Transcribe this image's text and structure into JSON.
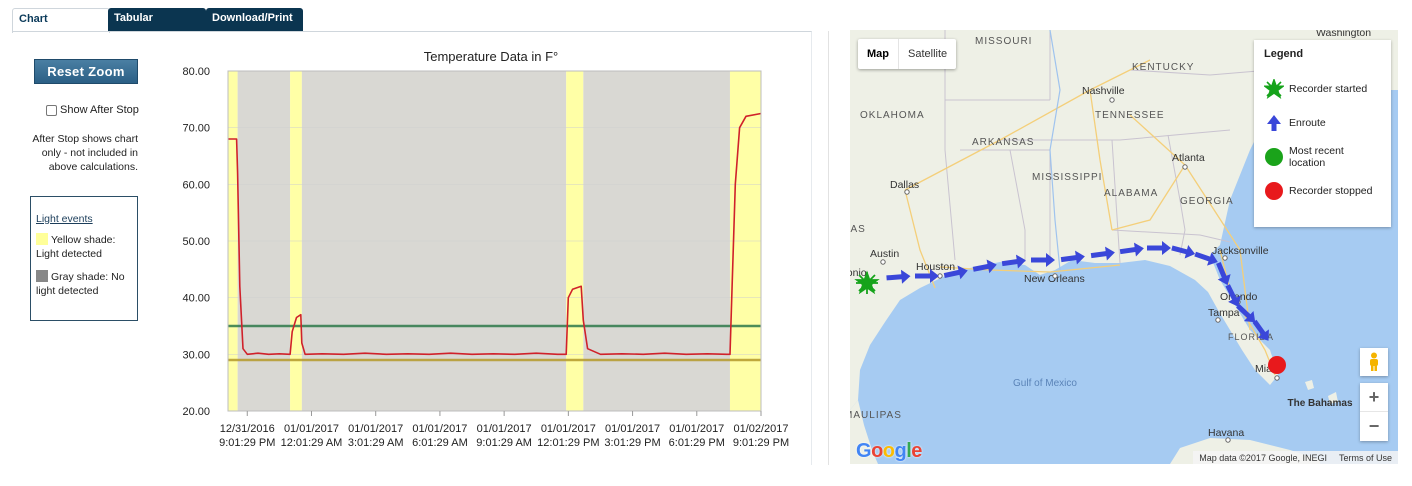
{
  "tabs": [
    {
      "label": "Chart",
      "active": true
    },
    {
      "label": "Tabular",
      "active": false
    },
    {
      "label": "Download/Print",
      "active": false
    }
  ],
  "controls": {
    "reset_zoom": "Reset Zoom",
    "show_after_stop": "Show After Stop",
    "show_after_stop_checked": false,
    "after_stop_note": "After Stop shows chart only - not included in above calculations."
  },
  "light_events": {
    "title": "Light events",
    "yellow": "Yellow shade: Light detected",
    "gray": "Gray shade: No light detected",
    "yellow_color": "#ffff99",
    "gray_color": "#888888"
  },
  "chart_data": {
    "type": "line",
    "title": "Temperature Data in F°",
    "ylim": [
      20,
      80
    ],
    "yticks": [
      "80.00",
      "70.00",
      "60.00",
      "50.00",
      "40.00",
      "30.00",
      "20.00"
    ],
    "xlim_hours": [
      -0.9,
      24.0
    ],
    "xticks": [
      {
        "h": 0,
        "l1": "12/31/2016",
        "l2": "9:01:29 PM"
      },
      {
        "h": 3,
        "l1": "01/01/2017",
        "l2": "12:01:29 AM"
      },
      {
        "h": 6,
        "l1": "01/01/2017",
        "l2": "3:01:29 AM"
      },
      {
        "h": 9,
        "l1": "01/01/2017",
        "l2": "6:01:29 AM"
      },
      {
        "h": 12,
        "l1": "01/01/2017",
        "l2": "9:01:29 AM"
      },
      {
        "h": 15,
        "l1": "01/01/2017",
        "l2": "12:01:29 PM"
      },
      {
        "h": 18,
        "l1": "01/01/2017",
        "l2": "3:01:29 PM"
      },
      {
        "h": 21,
        "l1": "01/01/2017",
        "l2": "6:01:29 PM"
      },
      {
        "h": 24,
        "l1": "01/02/2017",
        "l2": "9:01:29 PM"
      }
    ],
    "bands": [
      {
        "from": -0.9,
        "to": -0.45,
        "kind": "yellow"
      },
      {
        "from": -0.45,
        "to": 2.0,
        "kind": "gray"
      },
      {
        "from": 2.0,
        "to": 2.55,
        "kind": "yellow"
      },
      {
        "from": 2.55,
        "to": 14.9,
        "kind": "gray"
      },
      {
        "from": 14.9,
        "to": 15.7,
        "kind": "yellow"
      },
      {
        "from": 15.7,
        "to": 22.55,
        "kind": "gray"
      },
      {
        "from": 22.55,
        "to": 24.0,
        "kind": "yellow"
      }
    ],
    "thresholds": [
      {
        "value": 35,
        "color": "#2e7a4a"
      },
      {
        "value": 29,
        "color": "#b59a2a"
      }
    ],
    "series": [
      {
        "color": "#d0212a",
        "points": [
          [
            -0.9,
            68
          ],
          [
            -0.5,
            68
          ],
          [
            -0.45,
            62
          ],
          [
            -0.35,
            42
          ],
          [
            -0.2,
            31
          ],
          [
            0,
            30
          ],
          [
            0.5,
            30.2
          ],
          [
            1,
            30
          ],
          [
            1.5,
            30.1
          ],
          [
            2,
            30
          ],
          [
            2.1,
            34
          ],
          [
            2.3,
            36.5
          ],
          [
            2.5,
            37
          ],
          [
            2.55,
            32
          ],
          [
            2.7,
            30
          ],
          [
            3.5,
            30.1
          ],
          [
            4.5,
            30
          ],
          [
            5.5,
            30.2
          ],
          [
            6.5,
            30
          ],
          [
            7.5,
            30.1
          ],
          [
            8.5,
            30
          ],
          [
            9.5,
            30.2
          ],
          [
            10.5,
            30
          ],
          [
            11.5,
            30.1
          ],
          [
            12.5,
            30
          ],
          [
            13.5,
            30.2
          ],
          [
            14.5,
            30
          ],
          [
            14.9,
            30
          ],
          [
            15.0,
            40
          ],
          [
            15.2,
            41.5
          ],
          [
            15.6,
            42
          ],
          [
            15.7,
            36
          ],
          [
            15.9,
            31
          ],
          [
            16.5,
            30
          ],
          [
            17.5,
            30.1
          ],
          [
            18.5,
            30
          ],
          [
            19.5,
            30.2
          ],
          [
            20.5,
            30
          ],
          [
            21.5,
            30.1
          ],
          [
            22.4,
            30
          ],
          [
            22.55,
            30
          ],
          [
            22.65,
            42
          ],
          [
            22.8,
            60
          ],
          [
            23.0,
            70
          ],
          [
            23.3,
            72
          ],
          [
            24,
            72.5
          ]
        ]
      }
    ]
  },
  "map": {
    "maptype_options": [
      "Map",
      "Satellite"
    ],
    "maptype_selected": "Map",
    "legend": {
      "title": "Legend",
      "items": [
        {
          "label": "Recorder started",
          "icon": "green-star-icon",
          "color": "#16a31b"
        },
        {
          "label": "Enroute",
          "icon": "blue-arrow-icon",
          "color": "#3a47d9"
        },
        {
          "label": "Most recent location",
          "icon": "green-circle-icon",
          "color": "#1aa31a"
        },
        {
          "label": "Recorder stopped",
          "icon": "red-circle-icon",
          "color": "#e8191c"
        }
      ]
    },
    "labels": [
      {
        "text": "MISSOURI",
        "kind": "state"
      },
      {
        "text": "KENTUCKY",
        "kind": "state"
      },
      {
        "text": "TENNESSEE",
        "kind": "state"
      },
      {
        "text": "ARKANSAS",
        "kind": "state"
      },
      {
        "text": "OKLAHOMA",
        "kind": "state"
      },
      {
        "text": "MISSISSIPPI",
        "kind": "state"
      },
      {
        "text": "ALABAMA",
        "kind": "state"
      },
      {
        "text": "GEORGIA",
        "kind": "state"
      },
      {
        "text": "FLORIDA",
        "kind": "state"
      },
      {
        "text": "TEXAS",
        "kind": "state"
      },
      {
        "text": "TAMAULIPAS",
        "kind": "state"
      },
      {
        "text": "Nashville",
        "kind": "city"
      },
      {
        "text": "Atlanta",
        "kind": "city"
      },
      {
        "text": "Dallas",
        "kind": "city"
      },
      {
        "text": "Austin",
        "kind": "city"
      },
      {
        "text": "Houston",
        "kind": "city"
      },
      {
        "text": "San Antonio",
        "kind": "city"
      },
      {
        "text": "New Orleans",
        "kind": "city"
      },
      {
        "text": "Jacksonville",
        "kind": "city"
      },
      {
        "text": "Orlando",
        "kind": "city"
      },
      {
        "text": "Tampa",
        "kind": "city"
      },
      {
        "text": "Miami",
        "kind": "city"
      },
      {
        "text": "Havana",
        "kind": "city"
      },
      {
        "text": "Washington",
        "kind": "city"
      },
      {
        "text": "Gulf of Mexico",
        "kind": "water"
      },
      {
        "text": "The Bahamas",
        "kind": "country"
      }
    ],
    "google_logo": "Google",
    "attribution": "Map data ©2017 Google, INEGI",
    "terms": "Terms of Use",
    "zoom_in": "+",
    "zoom_out": "−"
  }
}
